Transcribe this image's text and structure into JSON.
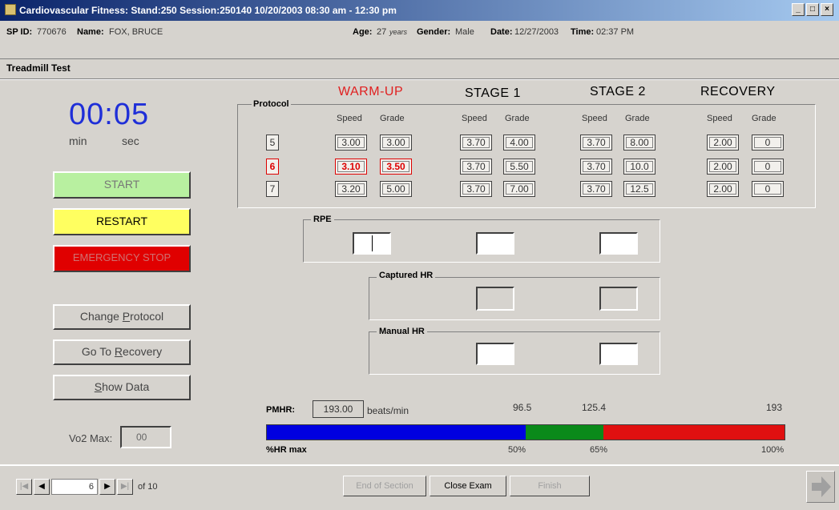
{
  "window": {
    "title": "Cardiovascular Fitness: Stand:250 Session:250140 10/20/2003 08:30 am - 12:30 pm",
    "controls": [
      "_",
      "□",
      "×"
    ]
  },
  "info": {
    "sp_id_label": "SP ID:",
    "sp_id": "770676",
    "name_label": "Name:",
    "name": "FOX, BRUCE",
    "age_label": "Age:",
    "age": "27",
    "age_unit": "years",
    "gender_label": "Gender:",
    "gender": "Male",
    "date_label": "Date:",
    "date": "12/27/2003",
    "time_label": "Time:",
    "time": "02:37 PM"
  },
  "section_title": "Treadmill Test",
  "timer": {
    "minutes": "00",
    "colon": ":",
    "seconds": "05",
    "min_label": "min",
    "sec_label": "sec"
  },
  "buttons": {
    "start": "START",
    "restart": "RESTART",
    "emergency": "EMERGENCY STOP",
    "change_protocol_pre": "Change ",
    "change_protocol_key": "P",
    "change_protocol_post": "rotocol",
    "go_recovery_pre": "Go To ",
    "go_recovery_key": "R",
    "go_recovery_post": "ecovery",
    "show_data_key": "S",
    "show_data_post": "how Data"
  },
  "vo2": {
    "label": "Vo2 Max:",
    "value": "00"
  },
  "protocol": {
    "label": "Protocol",
    "stages": [
      "WARM-UP",
      "STAGE 1",
      "STAGE 2",
      "RECOVERY"
    ],
    "speed_label": "Speed",
    "grade_label": "Grade",
    "rows": [
      {
        "id": "5",
        "values": [
          "3.00",
          "3.00",
          "3.70",
          "4.00",
          "3.70",
          "8.00",
          "2.00",
          "0"
        ]
      },
      {
        "id": "6",
        "values": [
          "3.10",
          "3.50",
          "3.70",
          "5.50",
          "3.70",
          "10.0",
          "2.00",
          "0"
        ]
      },
      {
        "id": "7",
        "values": [
          "3.20",
          "5.00",
          "3.70",
          "7.00",
          "3.70",
          "12.5",
          "2.00",
          "0"
        ]
      }
    ],
    "selected_row": 1
  },
  "groups": {
    "rpe": "RPE",
    "captured_hr": "Captured HR",
    "manual_hr": "Manual HR"
  },
  "pmhr": {
    "label": "PMHR:",
    "value": "193.00",
    "unit": "beats/min",
    "mark_50": "96.5",
    "mark_65": "125.4",
    "mark_100": "193",
    "pct_label": "%HR max",
    "pct_50": "50%",
    "pct_65": "65%",
    "pct_100": "100%",
    "colors": {
      "low": "#0000e0",
      "mid": "#0a8a1a",
      "high": "#e01010"
    },
    "zone_fractions": [
      0.5,
      0.65,
      1.0
    ]
  },
  "nav": {
    "current": "6",
    "of_label": "of 10",
    "end_section": "End of Section",
    "close_exam": "Close Exam",
    "finish": "Finish"
  }
}
